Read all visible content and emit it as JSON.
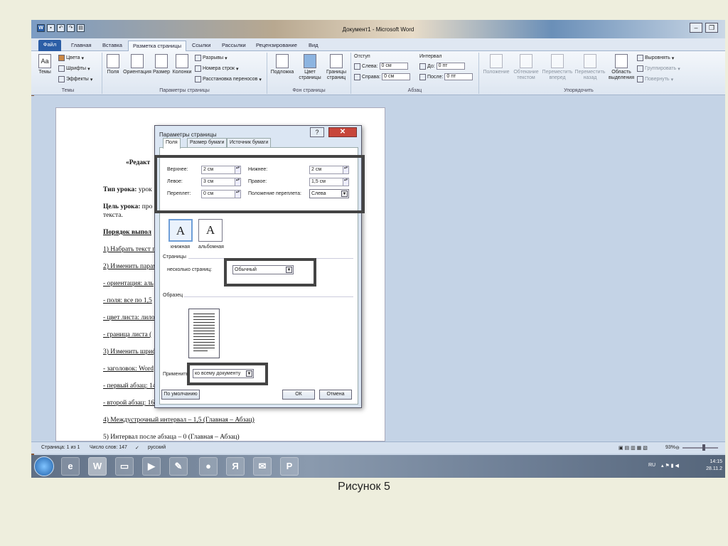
{
  "window": {
    "title": "Документ1 - Microsoft Word"
  },
  "tabs": [
    "Файл",
    "Главная",
    "Вставка",
    "Разметка страницы",
    "Ссылки",
    "Рассылки",
    "Рецензирование",
    "Вид"
  ],
  "ribbon": {
    "themes": {
      "big": "Темы",
      "colors": "Цвета",
      "fonts": "Шрифты",
      "effects": "Эффекты",
      "label": "Темы"
    },
    "page_setup": {
      "margins": "Поля",
      "orientation": "Ориентация",
      "size": "Размер",
      "columns": "Колонки",
      "breaks": "Разрывы",
      "line_numbers": "Номера строк",
      "hyphenation": "Расстановка переносов",
      "label": "Параметры страницы"
    },
    "background": {
      "watermark": "Подложка",
      "color_l1": "Цвет",
      "color_l2": "страницы",
      "borders_l1": "Границы",
      "borders_l2": "страниц",
      "label": "Фон страницы"
    },
    "paragraph": {
      "indent": "Отступ",
      "left": "Слева:",
      "left_val": "0 см",
      "right": "Справа:",
      "right_val": "0 см",
      "spacing": "Интервал",
      "before": "До:",
      "before_val": "0 пт",
      "after": "После:",
      "after_val": "0 пт",
      "label": "Абзац"
    },
    "arrange": {
      "position": "Положение",
      "wrap_l1": "Обтекание",
      "wrap_l2": "текстом",
      "forward_l1": "Переместить",
      "forward_l2": "вперед",
      "back_l1": "Переместить",
      "back_l2": "назад",
      "pane_l1": "Область",
      "pane_l2": "выделения",
      "align": "Выровнять",
      "group": "Группировать",
      "rotate": "Повернуть",
      "label": "Упорядочить"
    }
  },
  "document": {
    "heading": "«Редакт",
    "lines": [
      {
        "b": "Тип урока:",
        "t": " урок"
      },
      {
        "b": "Цель урока:",
        "t": " про"
      },
      {
        "b": "",
        "t": "текста."
      },
      {
        "b": "Порядок выпол",
        "t": ""
      },
      {
        "b": "",
        "t": "1) Набрать текст п"
      },
      {
        "b": "",
        "t": "2) Изменить парам"
      },
      {
        "b": "",
        "t": "- ориентация:  аль"
      },
      {
        "b": "",
        "t": "- поля:  все по 1,5"
      },
      {
        "b": "",
        "t": "- цвет листа: лило"
      },
      {
        "b": "",
        "t": "- граница   листа   ("
      },
      {
        "b": "",
        "t": "3) Изменить шриф"
      },
      {
        "b": "",
        "t": "- заголовок: Word"
      },
      {
        "b": "",
        "t": "- первый абзац: 14"
      },
      {
        "b": "",
        "t": "- второй абзац: 16"
      },
      {
        "b": "",
        "t": "4) Междустрочный интервал – 1,5 (Главная – Абзац)"
      },
      {
        "b": "",
        "t": "5) Интервал после абзаца – 0 (Главная – Абзац)"
      }
    ]
  },
  "dialog": {
    "title": "Параметры страницы",
    "tabs": [
      "Поля",
      "Размер бумаги",
      "Источник бумаги"
    ],
    "top_label": "Верхнее:",
    "top_val": "2 см",
    "bottom_label": "Нижнее:",
    "bottom_val": "2 см",
    "left_label": "Левое:",
    "left_val": "3 см",
    "right_label": "Правое:",
    "right_val": "1,5 см",
    "gutter_label": "Переплет:",
    "gutter_val": "0 см",
    "gutter_pos_label": "Положение переплета:",
    "gutter_pos_val": "Слева",
    "portrait": "книжная",
    "landscape": "альбомная",
    "pages_section": "Страницы",
    "multiple_label": "несколько страниц:",
    "multiple_val": "Обычный",
    "preview_section": "Образец",
    "apply_label": "Применить:",
    "apply_val": "ко всему документу",
    "default_btn": "По умолчанию",
    "ok_btn": "ОК",
    "cancel_btn": "Отмена"
  },
  "status": {
    "page": "Страница: 1 из 1",
    "words": "Число слов: 147",
    "lang": "русский",
    "zoom": "93%"
  },
  "taskbar": {
    "lang": "RU",
    "time": "14:15",
    "date": "28.11.2"
  },
  "caption": "Рисунок 5"
}
